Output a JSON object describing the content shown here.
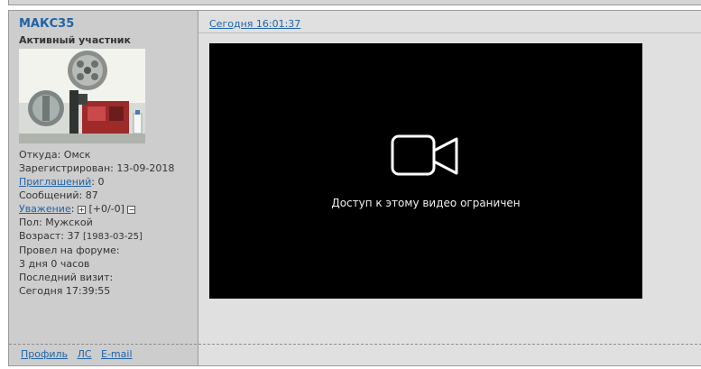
{
  "post": {
    "author": {
      "name": "МАКС35",
      "title": "Активный участник",
      "avatar_icon": "projector-photo",
      "from_label": "Откуда:",
      "from_value": "Омск",
      "registered_label": "Зарегистрирован:",
      "registered_value": "13-09-2018",
      "invites_label": "Приглашений",
      "invites_value": ": 0",
      "messages_label": "Сообщений:",
      "messages_value": "87",
      "respect_label": "Уважение",
      "respect_colon": ":",
      "respect_plus": "+",
      "respect_value": "[+0/-0]",
      "respect_minus": "−",
      "gender_label": "Пол:",
      "gender_value": "Мужской",
      "age_label": "Возраст:",
      "age_value": "37",
      "age_birth": "[1983-03-25]",
      "forum_time_label": "Провел на форуме:",
      "forum_time_value": "3 дня 0 часов",
      "last_visit_label": "Последний визит:",
      "last_visit_value": "Сегодня 17:39:55"
    },
    "date": "Сегодня 16:01:37",
    "video": {
      "icon": "video-camera-icon",
      "message": "Доступ к этому видео ограничен"
    },
    "footer": {
      "profile": "Профиль",
      "pm": "ЛС",
      "email": "E-mail"
    }
  }
}
